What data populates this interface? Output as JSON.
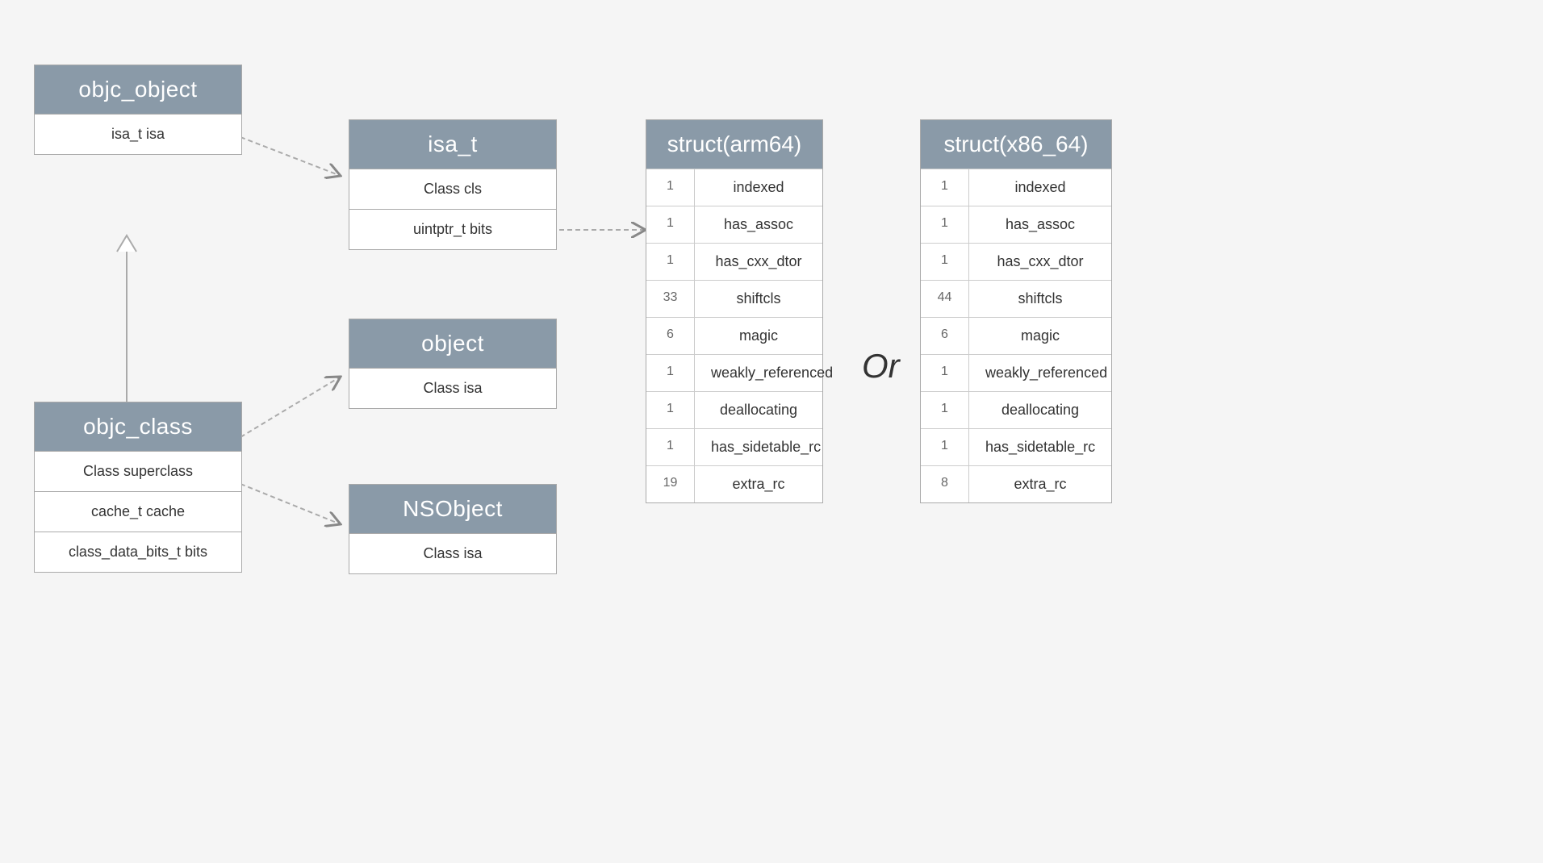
{
  "objc_object": {
    "title": "objc_object",
    "rows": [
      "isa_t isa"
    ]
  },
  "objc_class": {
    "title": "objc_class",
    "rows": [
      "Class superclass",
      "cache_t cache",
      "class_data_bits_t bits"
    ]
  },
  "isa_t": {
    "title": "isa_t",
    "rows": [
      "Class cls",
      "uintptr_t bits"
    ]
  },
  "object": {
    "title": "object",
    "rows": [
      "Class isa"
    ]
  },
  "nsobject": {
    "title": "NSObject",
    "rows": [
      "Class isa"
    ]
  },
  "struct_arm64": {
    "title": "struct(arm64)",
    "rows": [
      {
        "num": "1",
        "name": "indexed"
      },
      {
        "num": "1",
        "name": "has_assoc"
      },
      {
        "num": "1",
        "name": "has_cxx_dtor"
      },
      {
        "num": "33",
        "name": "shiftcls"
      },
      {
        "num": "6",
        "name": "magic"
      },
      {
        "num": "1",
        "name": "weakly_referenced"
      },
      {
        "num": "1",
        "name": "deallocating"
      },
      {
        "num": "1",
        "name": "has_sidetable_rc"
      },
      {
        "num": "19",
        "name": "extra_rc"
      }
    ]
  },
  "struct_x86_64": {
    "title": "struct(x86_64)",
    "rows": [
      {
        "num": "1",
        "name": "indexed"
      },
      {
        "num": "1",
        "name": "has_assoc"
      },
      {
        "num": "1",
        "name": "has_cxx_dtor"
      },
      {
        "num": "44",
        "name": "shiftcls"
      },
      {
        "num": "6",
        "name": "magic"
      },
      {
        "num": "1",
        "name": "weakly_referenced"
      },
      {
        "num": "1",
        "name": "deallocating"
      },
      {
        "num": "1",
        "name": "has_sidetable_rc"
      },
      {
        "num": "8",
        "name": "extra_rc"
      }
    ]
  },
  "or_label": "Or"
}
